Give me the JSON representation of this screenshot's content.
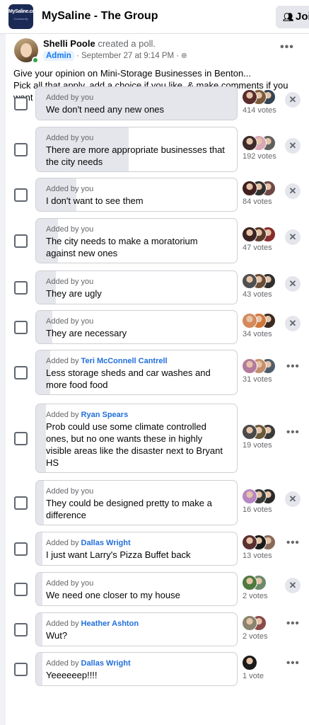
{
  "header": {
    "logo_text": "MySaline.co",
    "logo_sub": "Community",
    "group_title": "MySaline - The Group",
    "join_label": "Join"
  },
  "post": {
    "author": "Shelli Poole",
    "action": "created a poll.",
    "badge": "Admin",
    "timestamp": "September 27 at 9:14 PM",
    "text_line1": "Give your opinion on Mini-Storage Businesses in Benton...",
    "text_line2": "Pick all that apply, add a choice if you like, & make comments if you want to be more specific."
  },
  "poll": {
    "options": [
      {
        "added_prefix": "Added by",
        "added_by": "you",
        "label": "We don't need any new ones",
        "votes": "414 votes",
        "fill": 1.0,
        "action": "remove"
      },
      {
        "added_prefix": "Added by",
        "added_by": "you",
        "label": "There are more appropriate businesses that the city needs",
        "votes": "192 votes",
        "fill": 0.46,
        "action": "remove"
      },
      {
        "added_prefix": "Added by",
        "added_by": "you",
        "label": "I don't want to see them",
        "votes": "84 votes",
        "fill": 0.2,
        "action": "remove"
      },
      {
        "added_prefix": "Added by",
        "added_by": "you",
        "label": "The city needs to make a moratorium against new ones",
        "votes": "47 votes",
        "fill": 0.11,
        "action": "remove"
      },
      {
        "added_prefix": "Added by",
        "added_by": "you",
        "label": "They are ugly",
        "votes": "43 votes",
        "fill": 0.1,
        "action": "remove"
      },
      {
        "added_prefix": "Added by",
        "added_by": "you",
        "label": "They are necessary",
        "votes": "34 votes",
        "fill": 0.08,
        "action": "remove"
      },
      {
        "added_prefix": "Added by",
        "added_by": "Teri McConnell Cantrell",
        "label": "Less storage sheds and car washes and more food food",
        "votes": "31 votes",
        "fill": 0.07,
        "action": "more"
      },
      {
        "added_prefix": "Added by",
        "added_by": "Ryan Spears",
        "label": "Prob could use some climate controlled ones, but no one wants these in highly visible areas like the disaster next to Bryant HS",
        "votes": "19 votes",
        "fill": 0.05,
        "action": "more"
      },
      {
        "added_prefix": "Added by",
        "added_by": "you",
        "label": "They could be designed pretty to make a difference",
        "votes": "16 votes",
        "fill": 0.04,
        "action": "remove"
      },
      {
        "added_prefix": "Added by",
        "added_by": "Dallas Wright",
        "label": "I just want Larry's Pizza Buffet back",
        "votes": "13 votes",
        "fill": 0.03,
        "action": "more"
      },
      {
        "added_prefix": "Added by",
        "added_by": "you",
        "label": "We need one closer to my house",
        "votes": "2 votes",
        "fill": 0.01,
        "action": "remove"
      },
      {
        "added_prefix": "Added by",
        "added_by": "Heather Ashton",
        "label": "Wut?",
        "votes": "2 votes",
        "fill": 0.01,
        "action": "more"
      },
      {
        "added_prefix": "Added by",
        "added_by": "Dallas Wright",
        "label": "Yeeeeeep!!!!",
        "votes": "1 vote",
        "fill": 0.005,
        "action": "more"
      }
    ]
  },
  "icons": {
    "remove": "close-icon",
    "more": "more-options-icon",
    "globe": "globe-icon",
    "join": "group-join-icon"
  },
  "colors": {
    "brand": "#1877f2",
    "name_link": "#216fdb",
    "online": "#31a24c",
    "bar_fill": "#e4e6eb"
  }
}
